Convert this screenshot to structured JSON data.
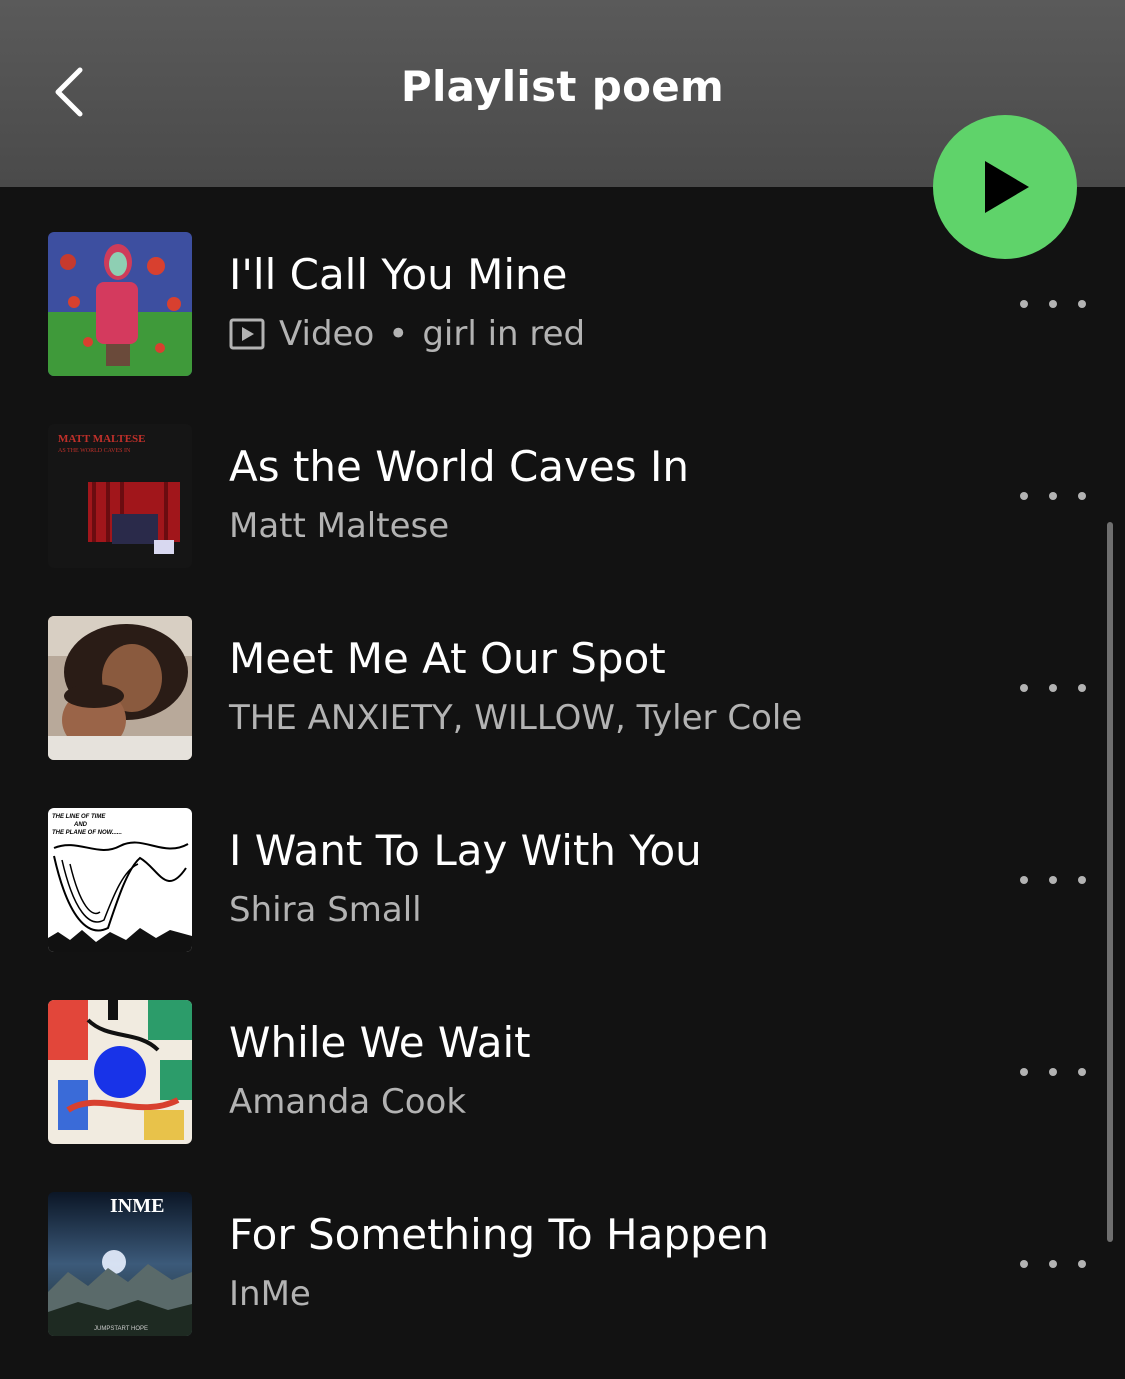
{
  "header": {
    "title": "Playlist poem",
    "back_icon": "chevron-left-icon",
    "play_icon": "play-icon",
    "accent_color": "#5fd36a"
  },
  "tracks": [
    {
      "title": "I'll Call You Mine",
      "type_label": "Video",
      "separator": "•",
      "artist": "girl in red"
    },
    {
      "title": "As the World Caves In",
      "artist": "Matt Maltese",
      "cover_text_1": "MATT MALTESE",
      "cover_text_2": "AS THE WORLD CAVES IN"
    },
    {
      "title": "Meet Me At Our Spot",
      "artist": "THE ANXIETY, WILLOW, Tyler Cole"
    },
    {
      "title": "I Want To Lay With You",
      "artist": "Shira Small",
      "cover_text_1": "THE LINE OF TIME",
      "cover_text_2": "AND",
      "cover_text_3": "THE PLANE OF NOW......"
    },
    {
      "title": "While We Wait",
      "artist": "Amanda Cook"
    },
    {
      "title": "For Something To Happen",
      "artist": "InMe",
      "cover_text_1": "INME",
      "cover_text_2": "JUMPSTART HOPE"
    }
  ],
  "more_icon": "more-horizontal-icon"
}
